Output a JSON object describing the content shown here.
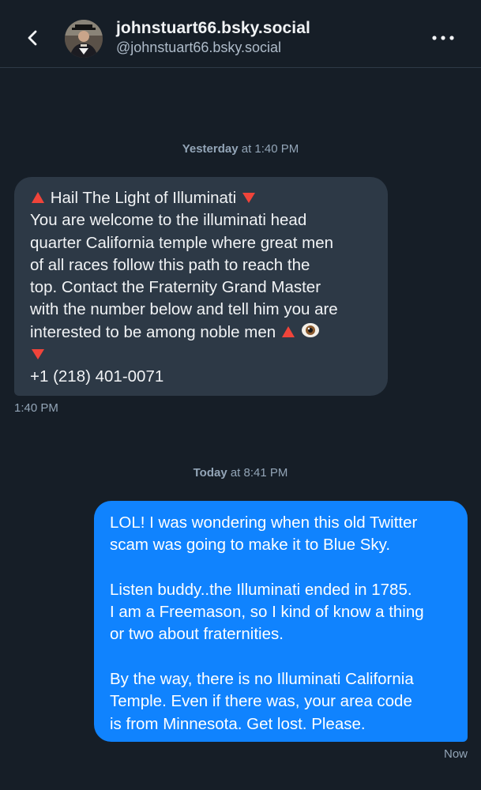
{
  "header": {
    "display_name": "johnstuart66.bsky.social",
    "handle": "@johnstuart66.bsky.social"
  },
  "icons": {
    "back": "chevron-left-icon",
    "more": "ellipsis-icon",
    "triangle_up": "red-triangle-up-emoji",
    "triangle_down": "red-triangle-down-emoji",
    "eye": "eye-emoji"
  },
  "colors": {
    "background": "#161e27",
    "incoming_bubble": "#2d3946",
    "outgoing_bubble": "#1083fe",
    "muted_text": "#93a5b7"
  },
  "messages": [
    {
      "date_day": "Yesterday",
      "date_time": "at 1:40 PM",
      "from": "them",
      "lines": [
        " Hail The Light of Illuminati ",
        "You are welcome to the illuminati head",
        "quarter California temple where great men",
        "of all races follow this path to reach the",
        "top. Contact the Fraternity Grand Master",
        "with the number below and tell him you are",
        "interested to be among noble men  ",
        "",
        "+1 (218) 401-0071"
      ],
      "time": "1:40 PM"
    },
    {
      "date_day": "Today",
      "date_time": "at 8:41 PM",
      "from": "me",
      "lines": [
        "LOL! I was wondering when this old Twitter",
        "scam was going to make it to Blue Sky.",
        "",
        "Listen buddy..the Illuminati ended in 1785.",
        "I am a Freemason, so I kind of know a thing",
        "or two about fraternities.",
        "",
        "By the way, there is no Illuminati California",
        "Temple. Even if there was, your area code",
        "is from Minnesota. Get lost. Please."
      ],
      "time": "Now"
    }
  ]
}
